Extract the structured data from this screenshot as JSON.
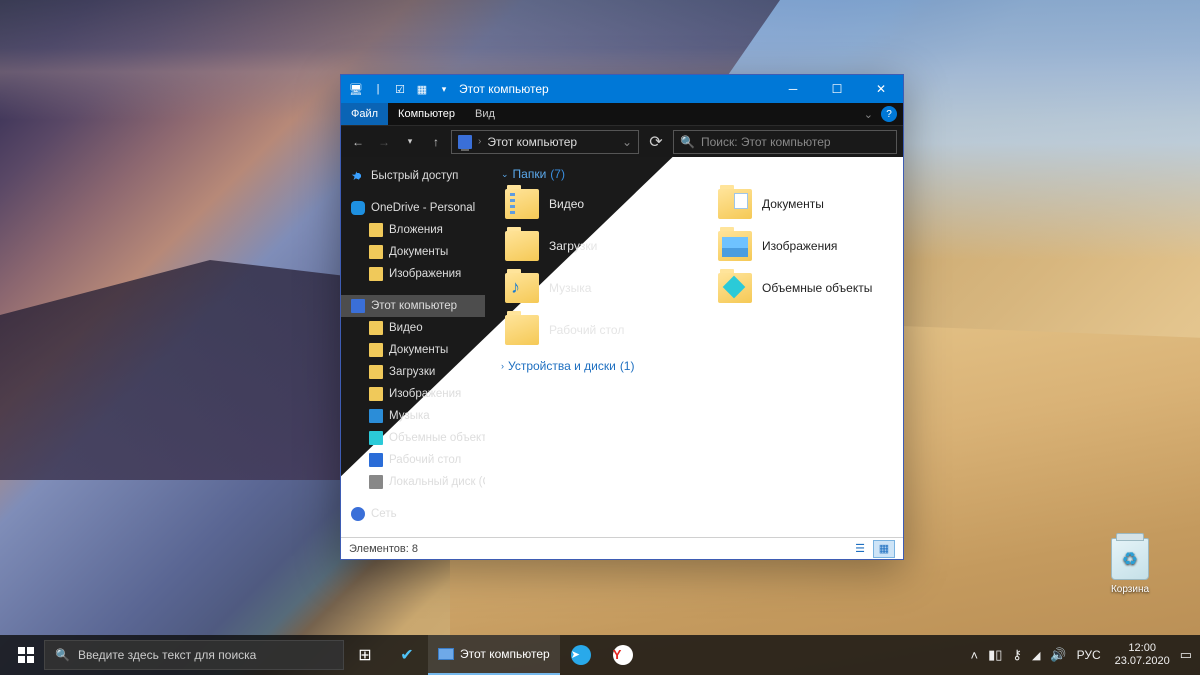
{
  "desktop": {
    "recycle_label": "Корзина"
  },
  "explorer": {
    "title": "Этот компьютер",
    "qat": {
      "pin": "📌",
      "props": "☑",
      "new": "▦",
      "dd": "▾"
    },
    "ribbon": {
      "file": "Файл",
      "computer": "Компьютер",
      "view": "Вид"
    },
    "nav": {
      "back": "←",
      "fwd": "→",
      "recent": "▾",
      "up": "↑",
      "refresh": "⟳"
    },
    "address": {
      "sep": "›",
      "location": "Этот компьютер",
      "dd": "⌄"
    },
    "search": {
      "icon": "🔍",
      "placeholder": "Поиск: Этот компьютер"
    },
    "sidebar": {
      "quick": "Быстрый доступ",
      "onedrive": "OneDrive - Personal",
      "od_children": [
        "Вложения",
        "Документы",
        "Изображения"
      ],
      "pc": "Этот компьютер",
      "pc_children": [
        "Видео",
        "Документы",
        "Загрузки",
        "Изображения",
        "Музыка",
        "Объемные объекты",
        "Рабочий стол",
        "Локальный диск (C:)"
      ],
      "network": "Сеть"
    },
    "groups": {
      "folders": {
        "label": "Папки",
        "count": "(7)"
      },
      "devices": {
        "label": "Устройства и диски",
        "count": "(1)"
      }
    },
    "folders": {
      "video": "Видео",
      "documents": "Документы",
      "downloads": "Загрузки",
      "pictures": "Изображения",
      "music": "Музыка",
      "objects3d": "Объемные объекты",
      "desktop": "Рабочий стол"
    },
    "status": {
      "items": "Элементов: 8"
    }
  },
  "taskbar": {
    "search_placeholder": "Введите здесь текст для поиска",
    "active_app": "Этот компьютер",
    "tray": {
      "lang": "РУС",
      "time": "12:00",
      "date": "23.07.2020"
    }
  }
}
